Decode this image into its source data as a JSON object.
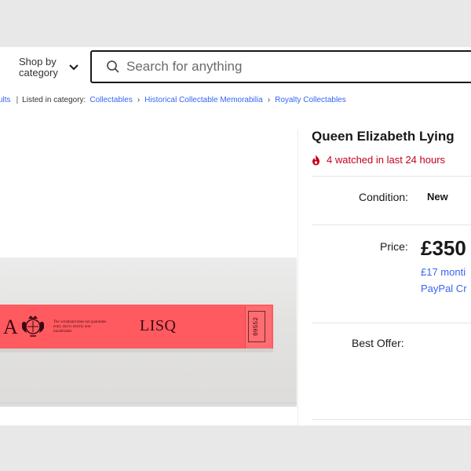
{
  "header": {
    "shop_by_label": "Shop by category",
    "search_placeholder": "Search for anything"
  },
  "breadcrumb": {
    "back_link": "ults",
    "listed_label": "Listed in category:",
    "items": [
      "Collectables",
      "Historical Collectable Memorabilia",
      "Royalty Collectables"
    ]
  },
  "listing": {
    "title": "Queen Elizabeth Lying",
    "watch_text": "4 watched in last 24 hours",
    "condition_label": "Condition:",
    "condition_value": "New",
    "price_label": "Price:",
    "price_value": "£350",
    "monthly_text": "£17 monti",
    "paypal_text": "PayPal Cr",
    "best_offer_label": "Best Offer:"
  },
  "photo": {
    "band_left_letter": "A",
    "band_fine_print": "The wristband does not guarantee entry and is strictly non-transferable",
    "band_code": "LISQ",
    "band_serial": "09552"
  },
  "colors": {
    "accent_link": "#3665f3",
    "watch_red": "#c5001a",
    "wristband": "#ff5a5f"
  }
}
